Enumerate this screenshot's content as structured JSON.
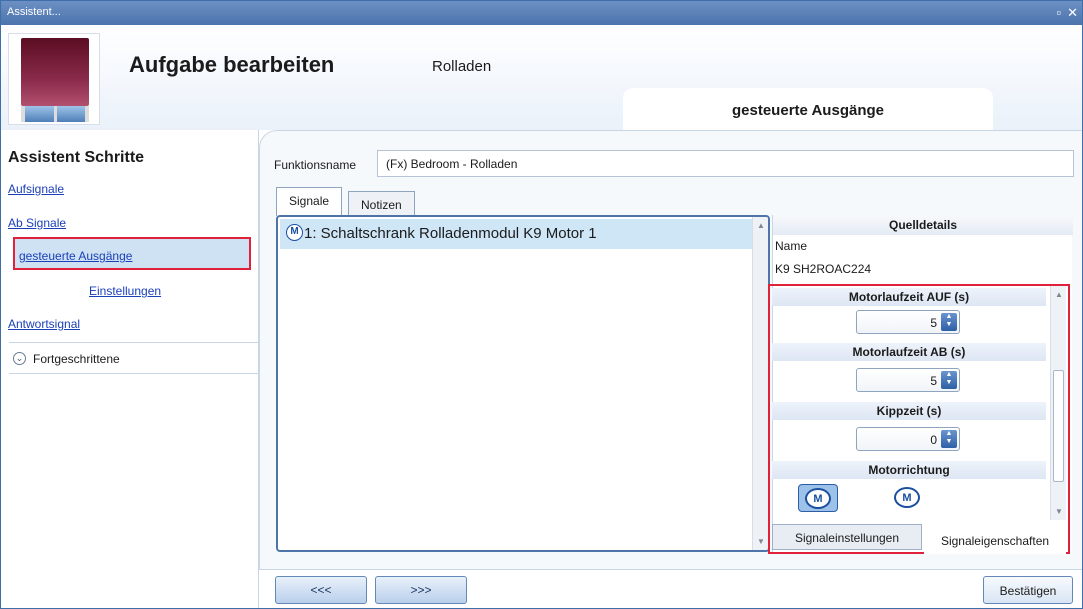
{
  "window": {
    "title": "Assistent..."
  },
  "header": {
    "title": "Aufgabe bearbeiten",
    "subtitle": "Rolladen",
    "step_tab": "gesteuerte Ausgänge"
  },
  "sidebar": {
    "heading": "Assistent Schritte",
    "items": [
      {
        "label": "Aufsignale"
      },
      {
        "label": "Ab Signale"
      },
      {
        "label": "gesteuerte Ausgänge"
      },
      {
        "label": "Einstellungen"
      },
      {
        "label": "Antwortsignal"
      }
    ],
    "advanced": "Fortgeschrittene"
  },
  "form": {
    "function_name_label": "Funktionsname",
    "function_name_value": "(Fx) Bedroom - Rolladen"
  },
  "tabs": [
    {
      "label": "Signale"
    },
    {
      "label": "Notizen"
    }
  ],
  "signal_list": [
    {
      "icon": "motor-icon",
      "icon_text": "M",
      "text": "1: Schaltschrank Rolladenmodul K9 Motor 1"
    }
  ],
  "details": {
    "heading": "Quelldetails",
    "name_label": "Name",
    "name_value": "K9 SH2ROAC224",
    "fields": [
      {
        "label": "Motorlaufzeit AUF (s)",
        "value": "5"
      },
      {
        "label": "Motorlaufzeit AB (s)",
        "value": "5"
      },
      {
        "label": "Kippzeit (s)",
        "value": "0"
      }
    ],
    "direction_label": "Motorrichtung",
    "direction_icon_text": "M",
    "tabs": [
      {
        "label": "Signaleinstellungen"
      },
      {
        "label": "Signaleigenschaften"
      }
    ]
  },
  "nav": {
    "back": "<<<",
    "forward": ">>>",
    "confirm": "Bestätigen"
  },
  "colors": {
    "accent": "#4c73ad",
    "highlight": "#e0213a",
    "selection": "#cfe2f4"
  }
}
